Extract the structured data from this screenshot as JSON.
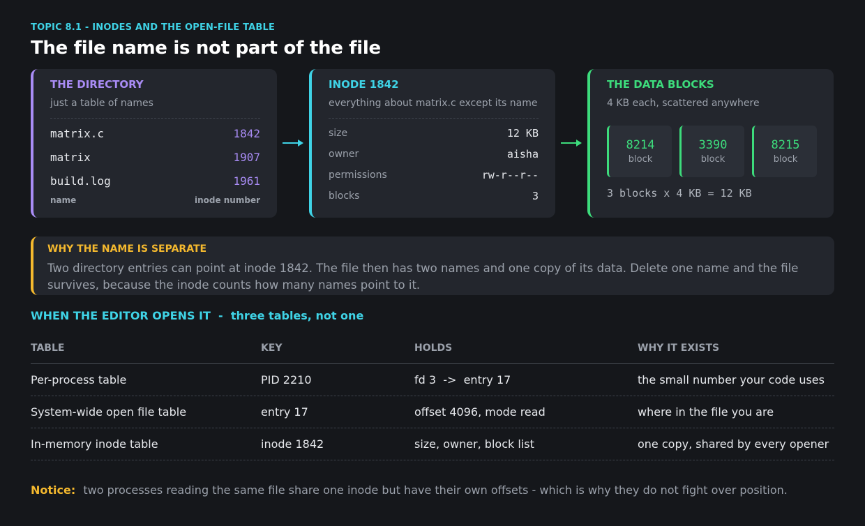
{
  "header": {
    "topic": "TOPIC 8.1  -  INODES AND THE OPEN-FILE TABLE",
    "title": "The file name is not part of the file"
  },
  "directory": {
    "title": "THE DIRECTORY",
    "subtitle": "just a table of names",
    "entries": [
      {
        "name": "matrix.c",
        "inode": "1842"
      },
      {
        "name": "matrix",
        "inode": "1907"
      },
      {
        "name": "build.log",
        "inode": "1961"
      }
    ],
    "col_name": "name",
    "col_inode": "inode number"
  },
  "inode": {
    "title": "INODE 1842",
    "subtitle": "everything about matrix.c except its name",
    "fields": [
      {
        "key": "size",
        "value": "12 KB"
      },
      {
        "key": "owner",
        "value": "aisha"
      },
      {
        "key": "permissions",
        "value": "rw-r--r--"
      },
      {
        "key": "blocks",
        "value": "3"
      }
    ]
  },
  "data_blocks": {
    "title": "THE DATA BLOCKS",
    "subtitle": "4 KB each, scattered anywhere",
    "blocks": [
      {
        "number": "8214",
        "label": "block"
      },
      {
        "number": "3390",
        "label": "block"
      },
      {
        "number": "8215",
        "label": "block"
      }
    ],
    "total": "3 blocks x 4 KB = 12 KB"
  },
  "why": {
    "title": "WHY THE NAME IS SEPARATE",
    "body": "Two directory entries can point at inode 1842. The file then has two names and one copy of its data. Delete one name and the file survives, because the inode counts how many names point to it."
  },
  "section": {
    "heading_a": "WHEN THE EDITOR OPENS IT  -  ",
    "heading_b": "three tables, not one"
  },
  "table": {
    "headers": [
      "TABLE",
      "KEY",
      "HOLDS",
      "WHY IT EXISTS"
    ],
    "rows": [
      [
        "Per-process table",
        "PID 2210",
        "fd 3  ->  entry 17",
        "the small number your code uses"
      ],
      [
        "System-wide open file table",
        "entry 17",
        "offset 4096, mode read",
        "where in the file you are"
      ],
      [
        "In-memory inode table",
        "inode 1842",
        "size, owner, block list",
        "one copy, shared by every opener"
      ]
    ]
  },
  "notice": {
    "label": "Notice:",
    "text": "two processes reading the same file share one inode but have their own offsets - which is why they do not fight over position."
  },
  "colors": {
    "directory": "#a98cf5",
    "inode": "#3fd3e6",
    "blocks": "#3ddc7c",
    "why": "#f5b92e",
    "background": "#15171b",
    "card": "#23262d"
  }
}
